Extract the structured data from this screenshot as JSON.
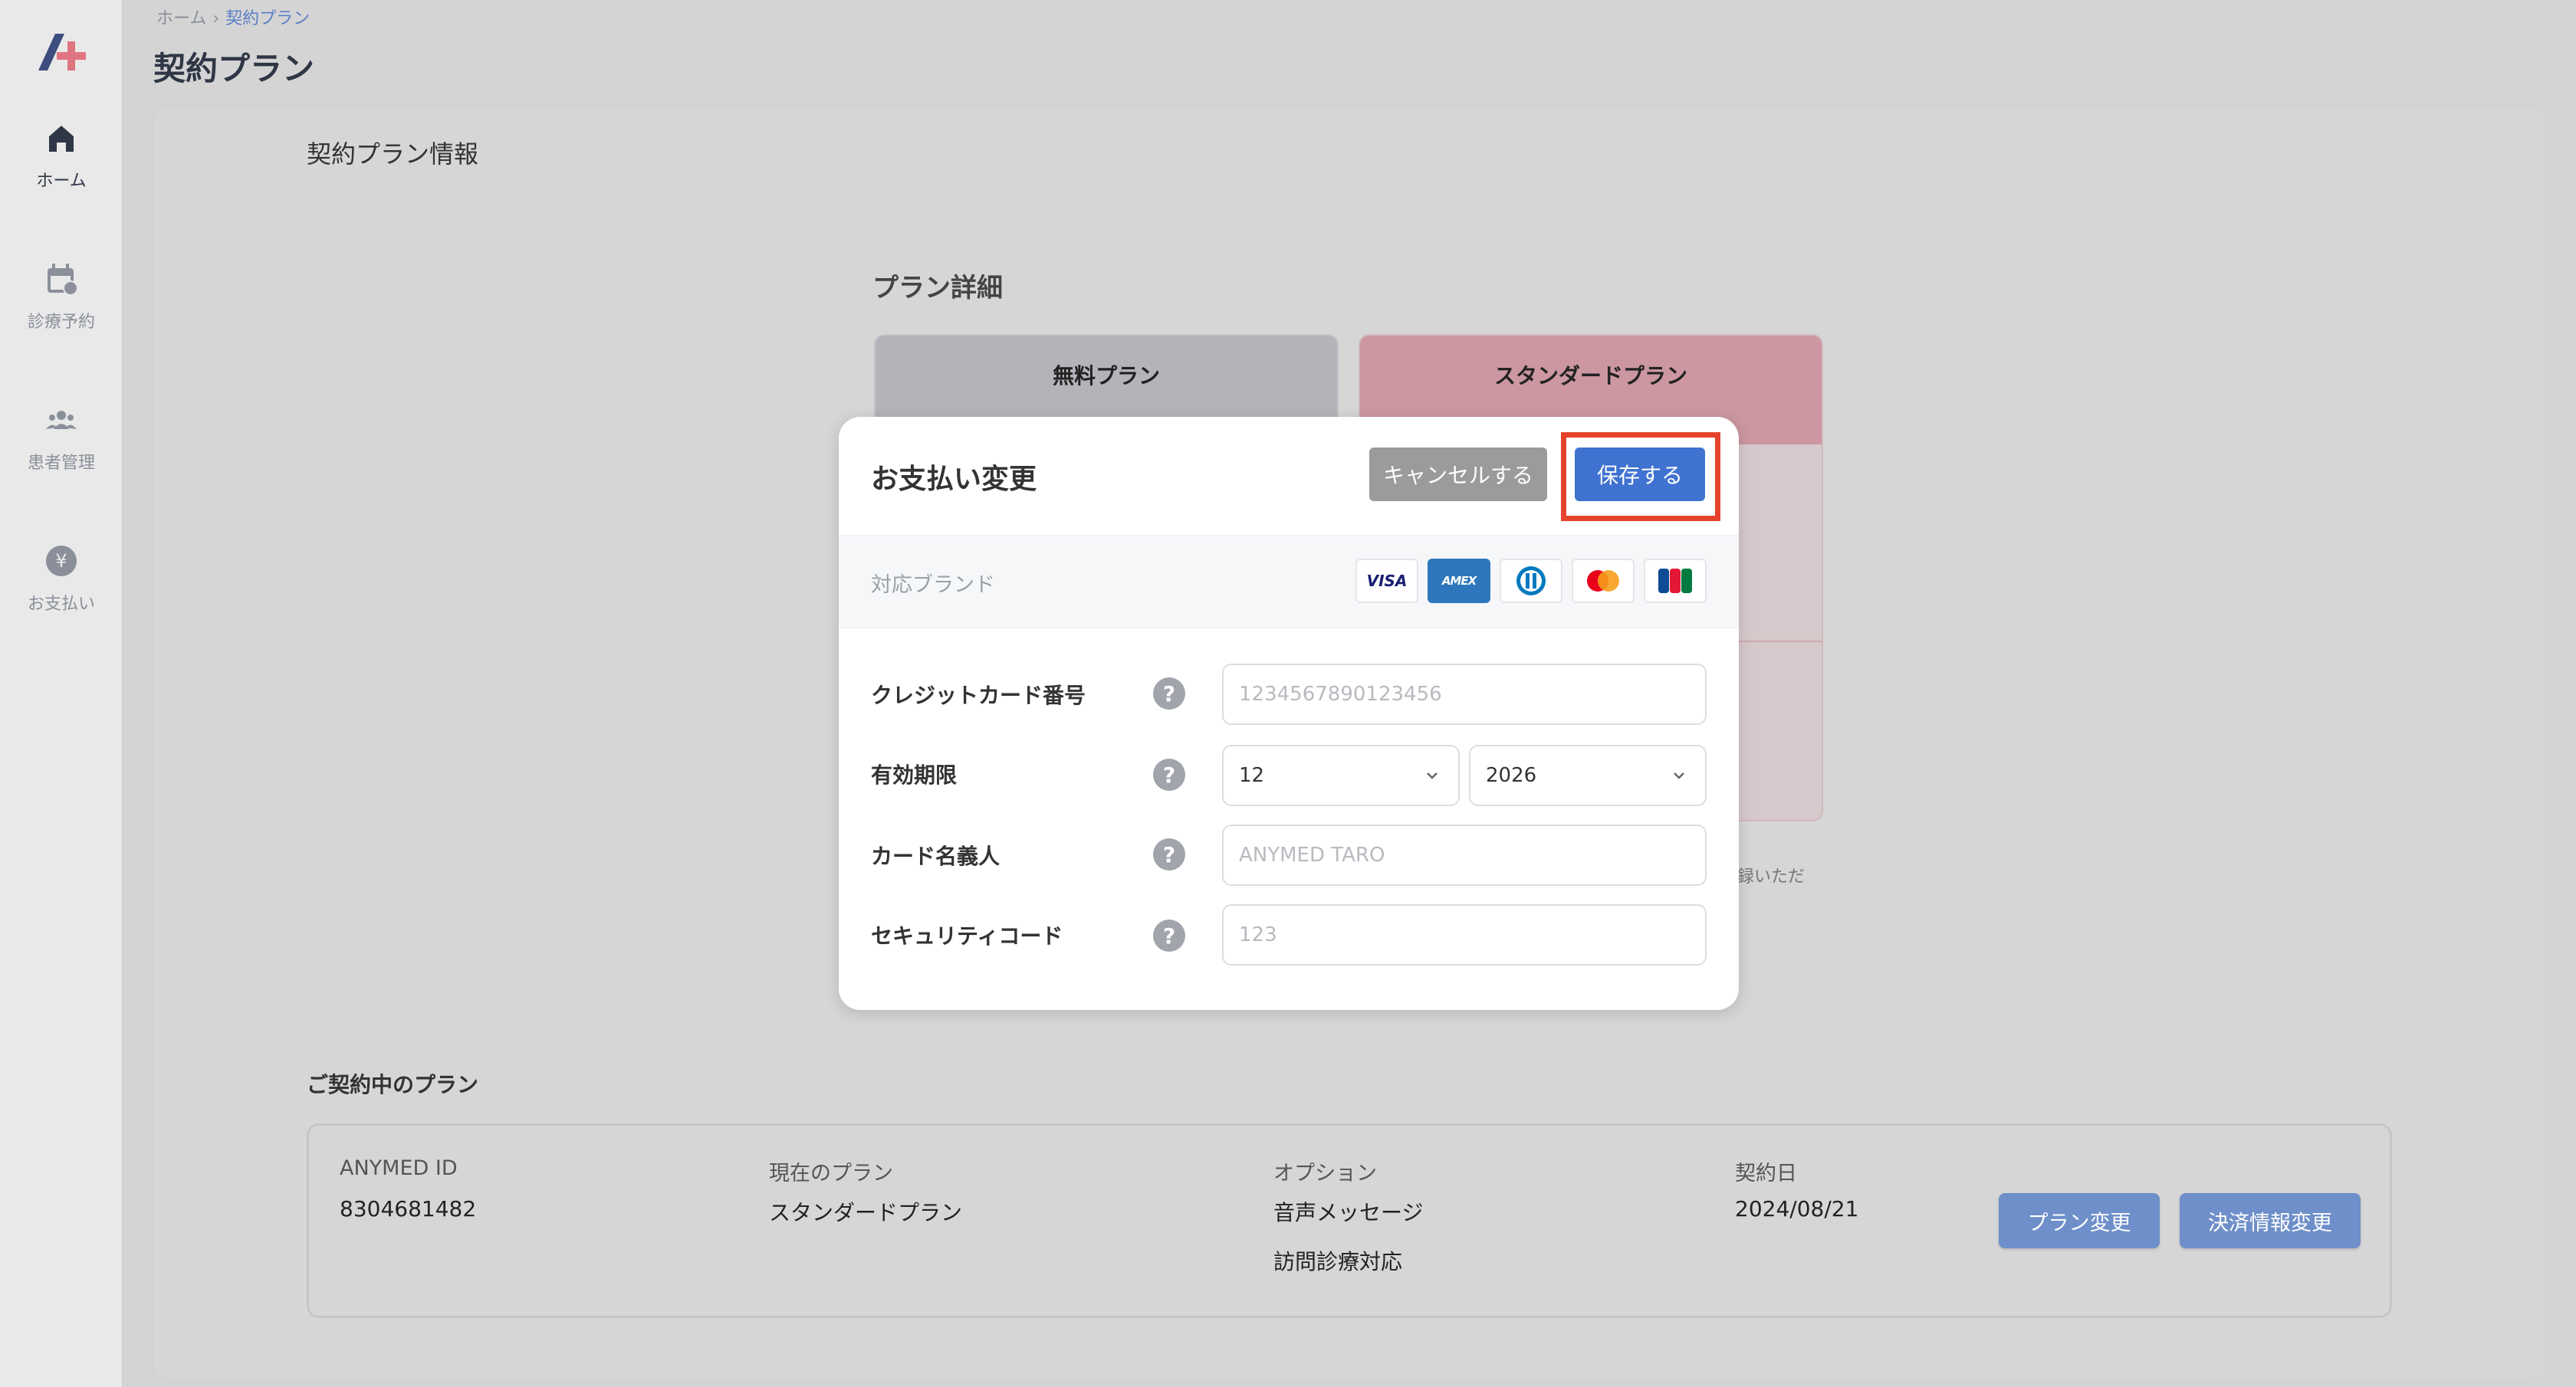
{
  "breadcrumb": {
    "home": "ホーム",
    "separator": "›",
    "current": "契約プラン"
  },
  "page_title": "契約プラン",
  "sidebar": {
    "items": [
      {
        "label": "ホーム",
        "icon": "home-icon"
      },
      {
        "label": "診療予約",
        "icon": "calendar-icon"
      },
      {
        "label": "患者管理",
        "icon": "people-icon"
      },
      {
        "label": "お支払い",
        "icon": "yen-icon"
      }
    ]
  },
  "section_title": "契約プラン情報",
  "plan_detail": {
    "title": "プラン詳細",
    "plans": [
      {
        "name": "無料プラン"
      },
      {
        "name": "スタンダードプラン"
      }
    ],
    "note_fragment": "録いただ"
  },
  "current_plan": {
    "title": "ご契約中のプラン",
    "anymed_id_label": "ANYMED ID",
    "anymed_id": "8304681482",
    "plan_label": "現在のプラン",
    "plan_value": "スタンダードプラン",
    "option_label": "オプション",
    "options": [
      "音声メッセージ",
      "訪問診療対応"
    ],
    "contract_date_label": "契約日",
    "contract_date": "2024/08/21",
    "change_plan_button": "プラン変更",
    "change_payment_button": "決済情報変更"
  },
  "modal": {
    "title": "お支払い変更",
    "cancel_button": "キャンセルする",
    "save_button": "保存する",
    "brand_label": "対応ブランド",
    "brands": [
      "VISA",
      "AMEX",
      "DINERS",
      "MASTERCARD",
      "JCB"
    ],
    "card_number_label": "クレジットカード番号",
    "card_number_placeholder": "1234567890123456",
    "expiry_label": "有効期限",
    "expiry_month": "12",
    "expiry_year": "2026",
    "holder_label": "カード名義人",
    "holder_placeholder": "ANYMED TARO",
    "security_label": "セキュリティコード",
    "security_placeholder": "123",
    "help_symbol": "?"
  },
  "colors": {
    "primary": "#3f72d1",
    "highlight": "#e5432c",
    "standard_plan": "#cc97a1"
  }
}
